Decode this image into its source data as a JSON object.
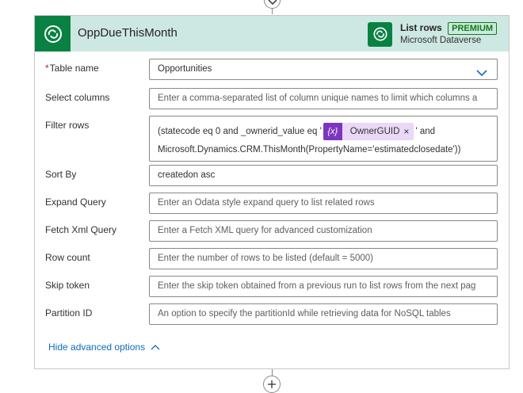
{
  "trigger_card": {
    "title": "OppDueThisMonth",
    "action": {
      "name": "List rows",
      "badge": "PREMIUM",
      "connector": "Microsoft Dataverse"
    }
  },
  "fields": {
    "table_name": {
      "label": "Table name",
      "required_marker": "*",
      "value": "Opportunities"
    },
    "select_columns": {
      "label": "Select columns",
      "placeholder": "Enter a comma-separated list of column unique names to limit which columns a"
    },
    "filter_rows": {
      "label": "Filter rows",
      "line1_prefix": "(statecode eq 0 and _ownerid_value eq '",
      "token_icon": "{x}",
      "token_label": "OwnerGUID",
      "token_close": "×",
      "line1_suffix": "' and",
      "line2": "Microsoft.Dynamics.CRM.ThisMonth(PropertyName='estimatedclosedate'))"
    },
    "sort_by": {
      "label": "Sort By",
      "value": "createdon asc"
    },
    "expand_query": {
      "label": "Expand Query",
      "placeholder": "Enter an Odata style expand query to list related rows"
    },
    "fetch_xml": {
      "label": "Fetch Xml Query",
      "placeholder": "Enter a Fetch XML query for advanced customization"
    },
    "row_count": {
      "label": "Row count",
      "placeholder": "Enter the number of rows to be listed (default = 5000)"
    },
    "skip_token": {
      "label": "Skip token",
      "placeholder": "Enter the skip token obtained from a previous run to list rows from the next pag"
    },
    "partition_id": {
      "label": "Partition ID",
      "placeholder": "An option to specify the partitionId while retrieving data for NoSQL tables"
    }
  },
  "advanced_toggle": "Hide advanced options",
  "icons": {
    "header": "dataverse-icon",
    "action": "dataverse-icon",
    "select": "chevron-down-icon",
    "toggle": "chevron-up-icon",
    "add_step": "plus-icon",
    "flow_arrow": "arrow-down-icon"
  },
  "colors": {
    "header_bg": "#cde8e2",
    "icon_bg": "#088142",
    "premium": "#107c10",
    "token_bg": "#e9d9f7",
    "token_icon_bg": "#7d35c1",
    "link": "#0f6cbd"
  }
}
